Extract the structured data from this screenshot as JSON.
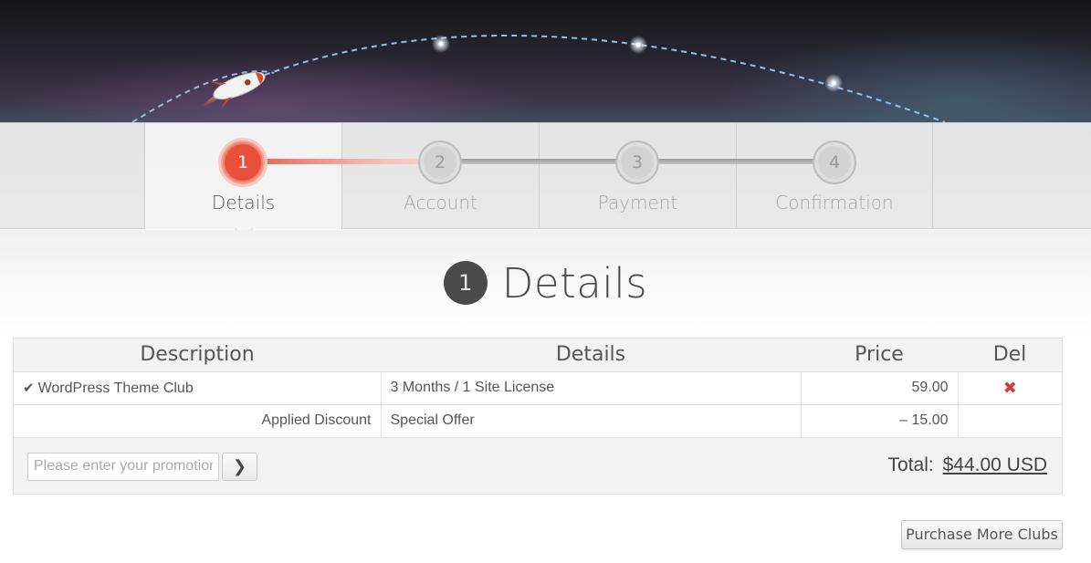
{
  "steps": [
    {
      "number": "1",
      "label": "Details",
      "active": true
    },
    {
      "number": "2",
      "label": "Account",
      "active": false
    },
    {
      "number": "3",
      "label": "Payment",
      "active": false
    },
    {
      "number": "4",
      "label": "Confirmation",
      "active": false
    }
  ],
  "heading": {
    "number": "1",
    "title": "Details"
  },
  "cart": {
    "columns": [
      "Description",
      "Details",
      "Price",
      "Del"
    ],
    "rows": [
      {
        "description": "WordPress Theme Club",
        "details": "3 Months / 1 Site License",
        "price": "59.00",
        "delete_icon": "x-icon"
      },
      {
        "description": "Applied Discount",
        "details": "Special Offer",
        "price": "– 15.00"
      }
    ],
    "promo": {
      "placeholder": "Please enter your promotion code",
      "apply_icon": "chevron-right-icon"
    },
    "total_label": "Total:",
    "total_amount": "$44.00 USD"
  },
  "purchase_more_label": "Purchase More Clubs",
  "colors": {
    "accent": "#e8503b",
    "delete": "#d33b3b"
  }
}
